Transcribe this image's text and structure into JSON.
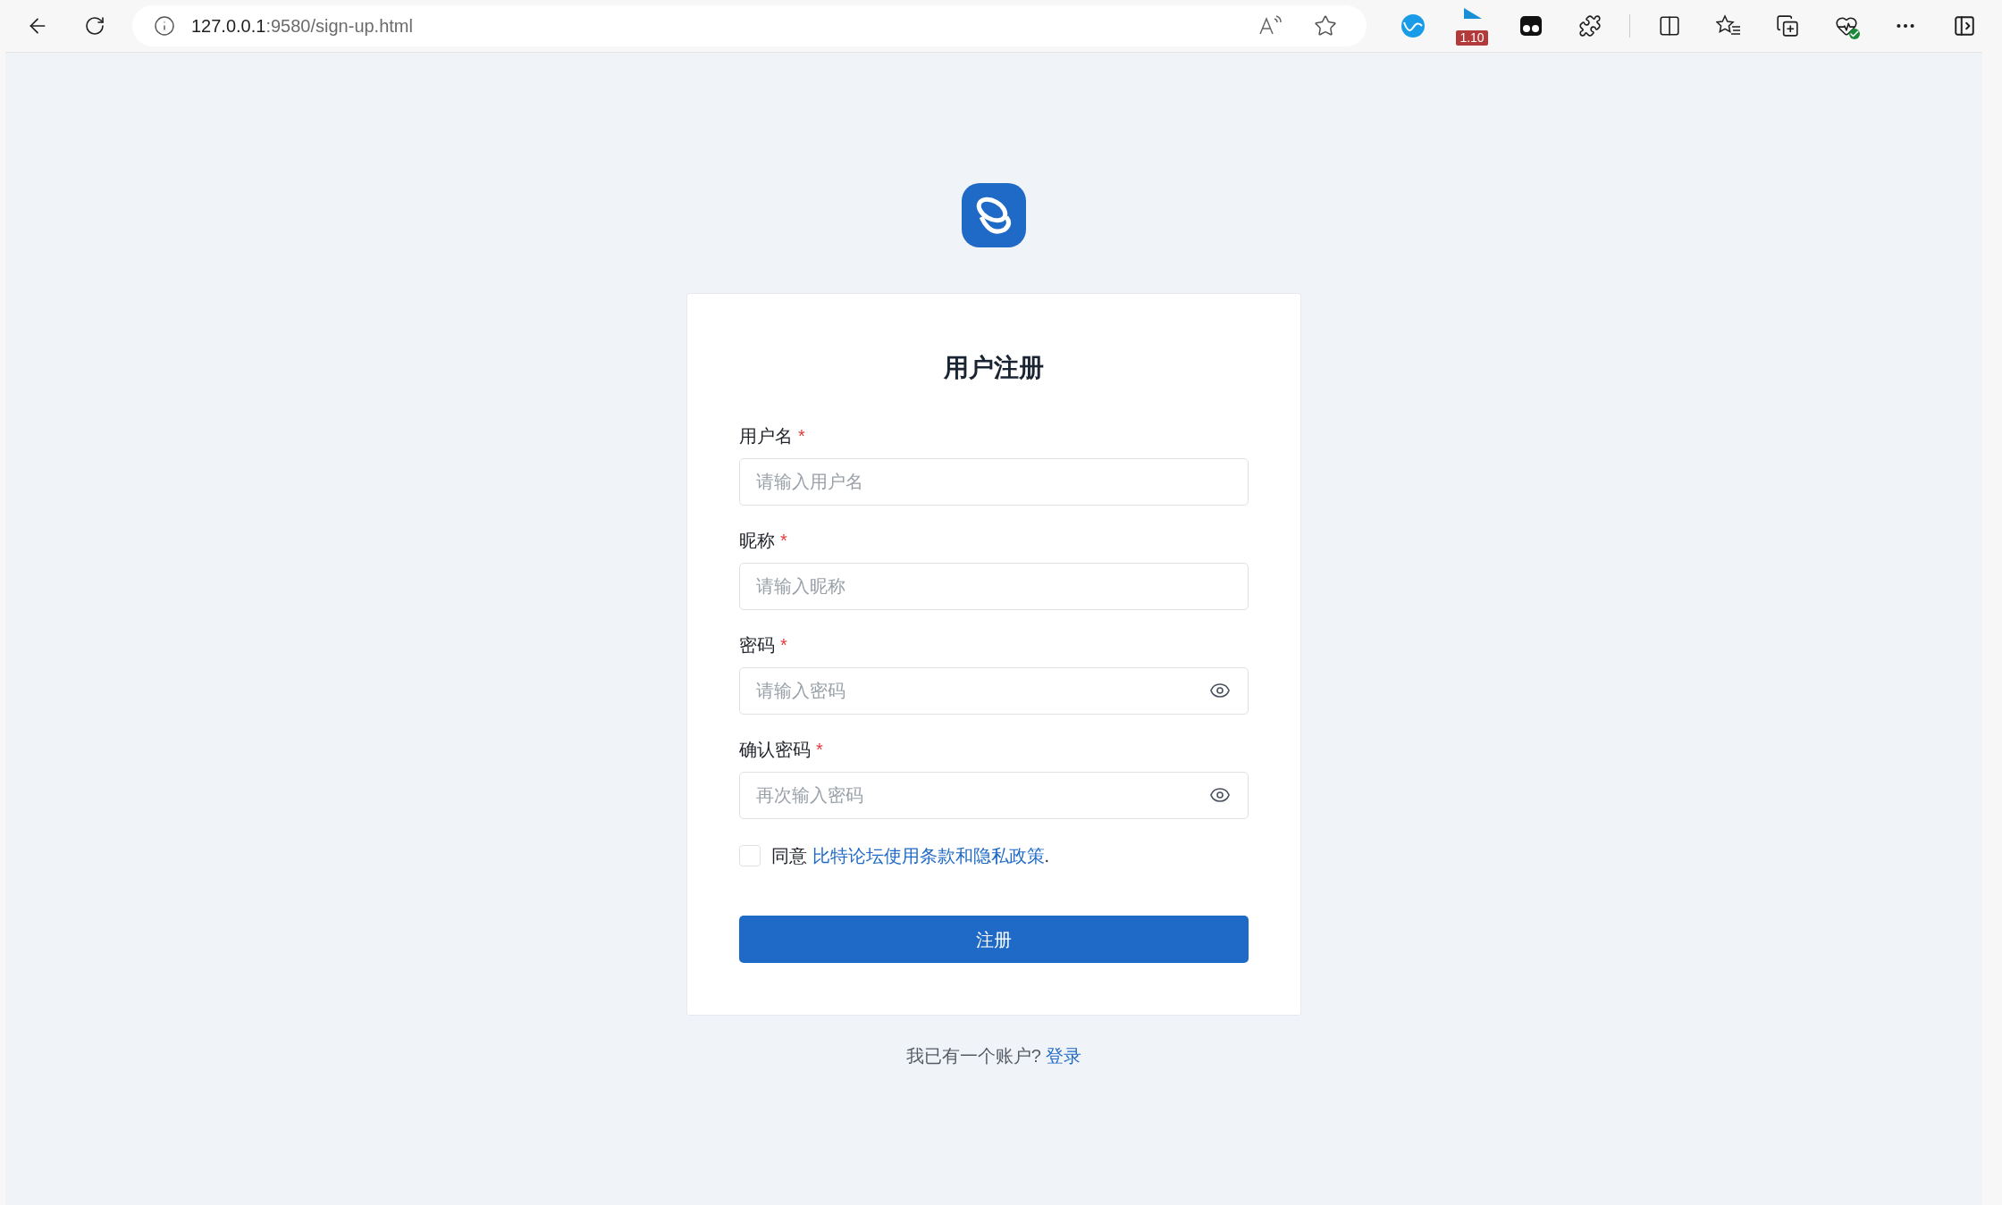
{
  "browser": {
    "url_host": "127.0.0.1",
    "url_path": ":9580/sign-up.html",
    "extension_badge": "1.10"
  },
  "form": {
    "title": "用户注册",
    "fields": [
      {
        "label": "用户名",
        "required_mark": "*",
        "placeholder": "请输入用户名",
        "kind": "text"
      },
      {
        "label": "昵称",
        "required_mark": "*",
        "placeholder": "请输入昵称",
        "kind": "text"
      },
      {
        "label": "密码",
        "required_mark": "*",
        "placeholder": "请输入密码",
        "kind": "password"
      },
      {
        "label": "确认密码",
        "required_mark": "*",
        "placeholder": "再次输入密码",
        "kind": "password"
      }
    ],
    "agreement": {
      "checked": false,
      "prefix": "同意",
      "link": "比特论坛使用条款和隐私政策",
      "suffix": "."
    },
    "submit": "注册"
  },
  "footer": {
    "text": "我已有一个账户?",
    "link": "登录"
  }
}
